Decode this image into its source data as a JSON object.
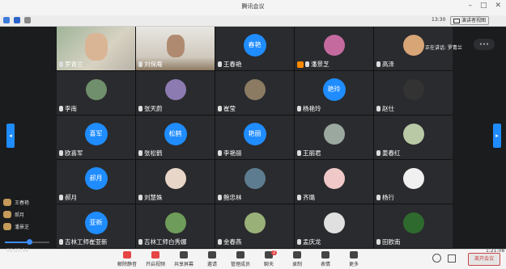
{
  "window": {
    "title": "腾讯会议"
  },
  "status": {
    "clock": "13:30",
    "speaker_view_label": "演讲者视图"
  },
  "speaking": {
    "label": "正在讲话: 罗青兰"
  },
  "participants": [
    {
      "name": "罗青兰",
      "type": "video1"
    },
    {
      "name": "刘保庵",
      "type": "video2"
    },
    {
      "name": "王春艳",
      "type": "circle",
      "avatar_text": "春艳",
      "color": "#1f8cff"
    },
    {
      "name": "潘景芝",
      "type": "img",
      "color": "#c46a9f",
      "host": true
    },
    {
      "name": "高泽",
      "type": "img",
      "color": "#d8a577"
    },
    {
      "name": "李南",
      "type": "img",
      "color": "#6f8f6d"
    },
    {
      "name": "张天蔚",
      "type": "img",
      "color": "#8c7bb1"
    },
    {
      "name": "崔莹",
      "type": "img",
      "color": "#8a7b62"
    },
    {
      "name": "杨艳玲",
      "type": "circle",
      "avatar_text": "艳玲",
      "color": "#1f8cff"
    },
    {
      "name": "赵仕",
      "type": "img",
      "color": "#333333"
    },
    {
      "name": "欧喜军",
      "type": "circle",
      "avatar_text": "喜军",
      "color": "#1f8cff"
    },
    {
      "name": "张松鹤",
      "type": "circle",
      "avatar_text": "松鹤",
      "color": "#1f8cff"
    },
    {
      "name": "李艳丽",
      "type": "circle",
      "avatar_text": "艳丽",
      "color": "#1f8cff"
    },
    {
      "name": "王丽君",
      "type": "img",
      "color": "#9aa8a0"
    },
    {
      "name": "姜春红",
      "type": "img",
      "color": "#b9c9a6"
    },
    {
      "name": "郝月",
      "type": "circle",
      "avatar_text": "郝月",
      "color": "#1f8cff"
    },
    {
      "name": "刘慧姝",
      "type": "img",
      "color": "#e8d6c8"
    },
    {
      "name": "鲍忠林",
      "type": "img",
      "color": "#5d7c90"
    },
    {
      "name": "齐璐",
      "type": "img",
      "color": "#f0c8c8"
    },
    {
      "name": "杨行",
      "type": "img",
      "color": "#f0f0f0"
    },
    {
      "name": "吉林工师崔亚新",
      "type": "circle",
      "avatar_text": "亚新",
      "color": "#1f8cff"
    },
    {
      "name": "吉林工师白秀娜",
      "type": "img",
      "color": "#6e9c5a"
    },
    {
      "name": "金春燕",
      "type": "img",
      "color": "#9ab079"
    },
    {
      "name": "孟庆龙",
      "type": "img",
      "color": "#e0e0e0"
    },
    {
      "name": "田欧南",
      "type": "img",
      "color": "#2e6a2e"
    }
  ],
  "raised_hands": [
    "王春艳",
    "郝月",
    "潘景芝"
  ],
  "time_elapsed": "00:03:04",
  "time_right": "1:21:08",
  "toolbar": [
    {
      "label": "解除静音",
      "icon": "mic-icon"
    },
    {
      "label": "开启视频",
      "icon": "camera-icon"
    },
    {
      "label": "共享屏幕",
      "icon": "share-screen-icon"
    },
    {
      "label": "邀请",
      "icon": "invite-icon"
    },
    {
      "label": "管理成员",
      "icon": "members-icon"
    },
    {
      "label": "聊天",
      "icon": "chat-icon",
      "badge": "2"
    },
    {
      "label": "录制",
      "icon": "record-icon"
    },
    {
      "label": "表情",
      "icon": "emoji-icon"
    },
    {
      "label": "更多",
      "icon": "more-icon"
    }
  ],
  "leave_label": "离开会议"
}
